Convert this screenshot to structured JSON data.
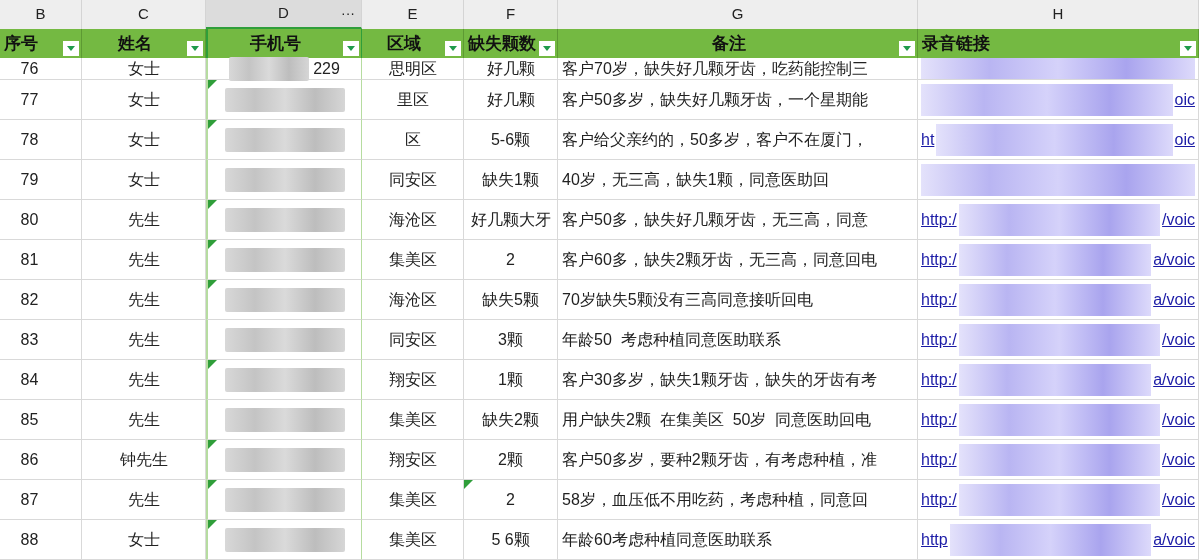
{
  "column_letters": [
    {
      "label": "B",
      "selected": false
    },
    {
      "label": "C",
      "selected": false
    },
    {
      "label": "D",
      "selected": true,
      "more": "···"
    },
    {
      "label": "E",
      "selected": false
    },
    {
      "label": "F",
      "selected": false
    },
    {
      "label": "G",
      "selected": false
    },
    {
      "label": "H",
      "selected": false
    }
  ],
  "fields": [
    {
      "label": "序号"
    },
    {
      "label": "姓名"
    },
    {
      "label": "手机号"
    },
    {
      "label": "区域"
    },
    {
      "label": "缺失颗数"
    },
    {
      "label": "备注"
    },
    {
      "label": "录音链接"
    }
  ],
  "rows": [
    {
      "no": "76",
      "name": "女士",
      "phone": "229",
      "phone_marked": false,
      "area": "思明区",
      "count": "好几颗",
      "count_marked": false,
      "note": "客户70岁，缺失好几颗牙齿，吃药能控制三",
      "link_start": "",
      "link_end": ""
    },
    {
      "no": "77",
      "name": "女士",
      "phone": "",
      "phone_marked": true,
      "area": "里区",
      "count": "好几颗",
      "count_marked": false,
      "note": "客户50多岁，缺失好几颗牙齿，一个星期能",
      "link_start": "",
      "link_end": "oic"
    },
    {
      "no": "78",
      "name": "女士",
      "phone": "",
      "phone_marked": true,
      "area": "区",
      "count": "5-6颗",
      "count_marked": false,
      "note": "客户给父亲约的，50多岁，客户不在厦门，",
      "link_start": "ht",
      "link_end": "oic"
    },
    {
      "no": "79",
      "name": "女士",
      "phone": "",
      "phone_marked": false,
      "area": "同安区",
      "count": "缺失1颗",
      "count_marked": false,
      "note": "40岁，无三高，缺失1颗，同意医助回",
      "link_start": "",
      "link_end": ""
    },
    {
      "no": "80",
      "name": "先生",
      "phone": "",
      "phone_marked": true,
      "area": "海沧区",
      "count": "好几颗大牙",
      "count_marked": false,
      "note": "客户50多，缺失好几颗牙齿，无三高，同意",
      "link_start": "http:/",
      "link_end": "/voic"
    },
    {
      "no": "81",
      "name": "先生",
      "phone": "",
      "phone_marked": true,
      "area": "集美区",
      "count": "2",
      "count_marked": false,
      "note": "客户60多，缺失2颗牙齿，无三高，同意回电",
      "link_start": "http:/",
      "link_end": "a/voic"
    },
    {
      "no": "82",
      "name": "先生",
      "phone": "",
      "phone_marked": true,
      "area": "海沧区",
      "count": "缺失5颗",
      "count_marked": false,
      "note": "70岁缺失5颗没有三高同意接听回电",
      "link_start": "http:/",
      "link_end": "a/voic"
    },
    {
      "no": "83",
      "name": "先生",
      "phone": "",
      "phone_marked": false,
      "area": "同安区",
      "count": "3颗",
      "count_marked": false,
      "note": "年龄50  考虑种植同意医助联系",
      "link_start": "http:/",
      "link_end": "/voic"
    },
    {
      "no": "84",
      "name": "先生",
      "phone": "",
      "phone_marked": true,
      "area": "翔安区",
      "count": "1颗",
      "count_marked": false,
      "note": "客户30多岁，缺失1颗牙齿，缺失的牙齿有考",
      "link_start": "http:/",
      "link_end": "a/voic"
    },
    {
      "no": "85",
      "name": "先生",
      "phone": "",
      "phone_marked": false,
      "area": "集美区",
      "count": "缺失2颗",
      "count_marked": false,
      "note": "用户缺失2颗  在集美区  50岁  同意医助回电",
      "link_start": "http:/",
      "link_end": "/voic"
    },
    {
      "no": "86",
      "name": "钟先生",
      "phone": "",
      "phone_marked": true,
      "area": "翔安区",
      "count": "2颗",
      "count_marked": false,
      "note": "客户50多岁，要种2颗牙齿，有考虑种植，准",
      "link_start": "http:/",
      "link_end": "/voic"
    },
    {
      "no": "87",
      "name": "先生",
      "phone": "",
      "phone_marked": true,
      "area": "集美区",
      "count": "2",
      "count_marked": true,
      "note": "58岁，血压低不用吃药，考虑种植，同意回",
      "link_start": "http:/",
      "link_end": "/voic"
    },
    {
      "no": "88",
      "name": "女士",
      "phone": "",
      "phone_marked": true,
      "area": "集美区",
      "count": "5 6颗",
      "count_marked": false,
      "note": "年龄60考虑种植同意医助联系",
      "link_start": "http",
      "link_end": "a/voic"
    }
  ]
}
